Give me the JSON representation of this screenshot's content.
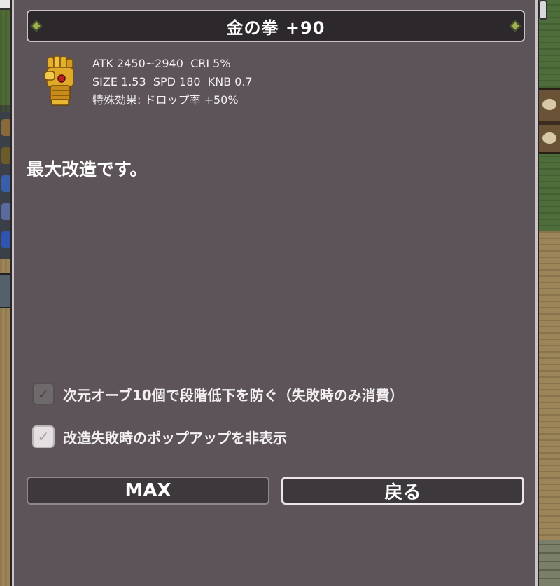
{
  "dialog": {
    "title": "金の拳 +90",
    "item_icon": "golden-fist-icon",
    "stats": [
      "ATK 2450~2940  CRI 5%",
      "SIZE 1.53  SPD 180  KNB 0.7",
      "特殊効果: ドロップ率 +50%"
    ],
    "message": "最大改造です。",
    "options": [
      {
        "label": "次元オーブ10個で段階低下を防ぐ（失敗時のみ消費）",
        "checked": true,
        "enabled": false
      },
      {
        "label": "改造失敗時のポップアップを非表示",
        "checked": true,
        "enabled": true
      }
    ],
    "buttons": {
      "max": "MAX",
      "back": "戻る"
    },
    "check_glyph": "✓"
  },
  "colors": {
    "panel": "#5d5459",
    "title_bar": "#2c282b",
    "border": "#c9c2c6",
    "ornament": "#9fb050",
    "gold": "#d9a520"
  }
}
